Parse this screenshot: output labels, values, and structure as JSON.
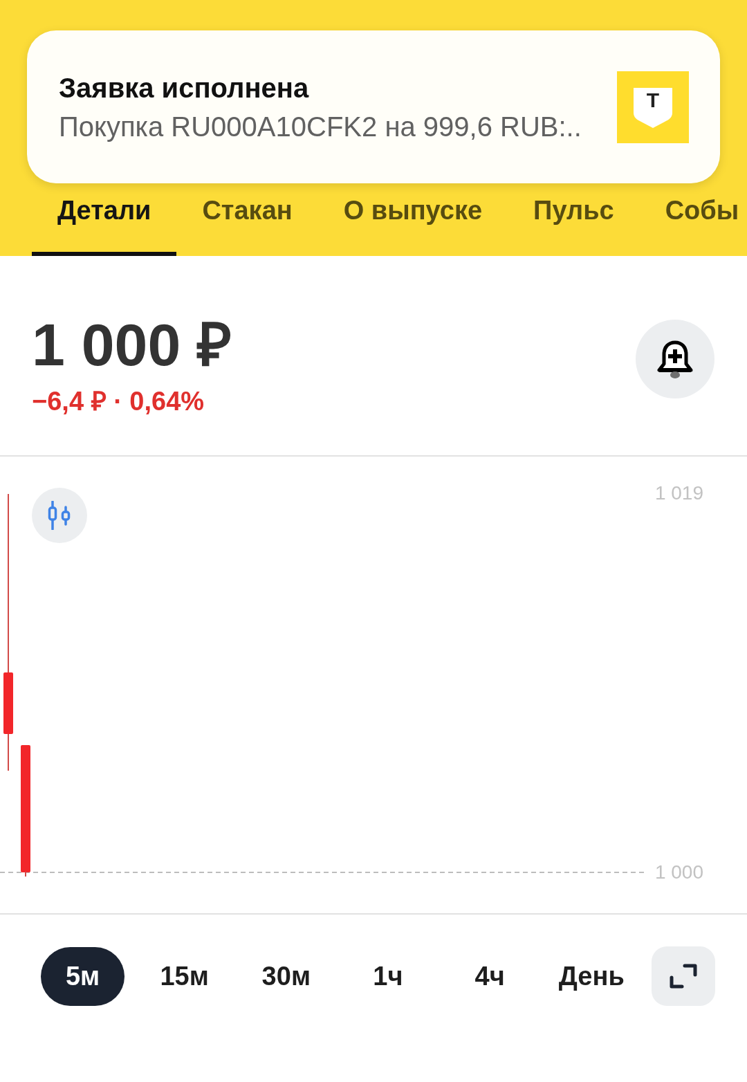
{
  "notification": {
    "title": "Заявка исполнена",
    "message": "Покупка RU000A10CFK2 на 999,6 RUB:..",
    "logo": "Т"
  },
  "tabs": [
    {
      "label": "Детали",
      "selected": true
    },
    {
      "label": "Стакан",
      "selected": false
    },
    {
      "label": "О выпуске",
      "selected": false
    },
    {
      "label": "Пульс",
      "selected": false
    },
    {
      "label": "Собы",
      "selected": false
    }
  ],
  "quote": {
    "price": "1 000 ₽",
    "change": "−6,4 ₽ · 0,64%",
    "negative": true
  },
  "chart": {
    "y_axis_labels": [
      "1 019",
      "1 000"
    ]
  },
  "intervals": [
    {
      "label": "5м",
      "selected": true
    },
    {
      "label": "15м",
      "selected": false
    },
    {
      "label": "30м",
      "selected": false
    },
    {
      "label": "1ч",
      "selected": false
    },
    {
      "label": "4ч",
      "selected": false
    },
    {
      "label": "День",
      "selected": false
    }
  ]
}
